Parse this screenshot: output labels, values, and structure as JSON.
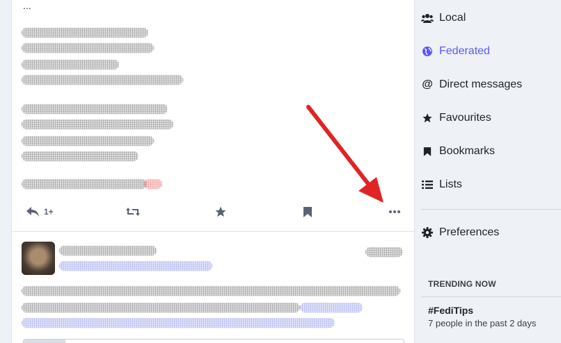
{
  "post1": {
    "ellipsis": "...",
    "reply_count": "1+"
  },
  "sidebar": {
    "items": [
      {
        "label": "Local",
        "icon": "users-icon"
      },
      {
        "label": "Federated",
        "icon": "globe-icon",
        "active": true
      },
      {
        "label": "Direct messages",
        "icon": "at-icon"
      },
      {
        "label": "Favourites",
        "icon": "star-icon"
      },
      {
        "label": "Bookmarks",
        "icon": "bookmark-icon"
      },
      {
        "label": "Lists",
        "icon": "list-icon"
      }
    ],
    "preferences": {
      "label": "Preferences",
      "icon": "gear-icon"
    }
  },
  "trending": {
    "heading": "TRENDING NOW",
    "tag": "#FediTips",
    "subtitle": "7 people in the past 2 days"
  },
  "colors": {
    "accent": "#595aff",
    "annotation_arrow": "#e02424"
  }
}
